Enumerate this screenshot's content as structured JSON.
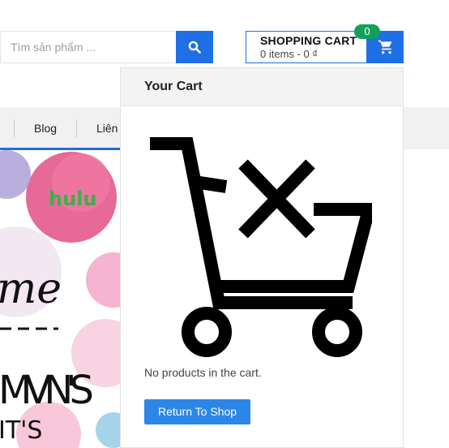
{
  "search": {
    "placeholder": "Tìm sản phẩm ...",
    "icon": "search-icon"
  },
  "cart": {
    "title": "SHOPPING CART",
    "summary": "0 items - 0 ₫",
    "count": "0",
    "icon": "shopping-cart-icon"
  },
  "nav": {
    "items": [
      {
        "label": "Blog"
      },
      {
        "label": "Liên"
      }
    ]
  },
  "banner": {
    "brand": "hulu",
    "texts": [
      "me",
      "MVN'S",
      "IT'S"
    ]
  },
  "cart_dropdown": {
    "title": "Your Cart",
    "empty_message": "No products in the cart.",
    "return_button": "Return To Shop",
    "icon": "empty-cart-icon"
  },
  "colors": {
    "primary": "#1f6fe5",
    "badge": "#12a15a",
    "button": "#2b86e8",
    "nav_bg": "#f1f1f1"
  }
}
